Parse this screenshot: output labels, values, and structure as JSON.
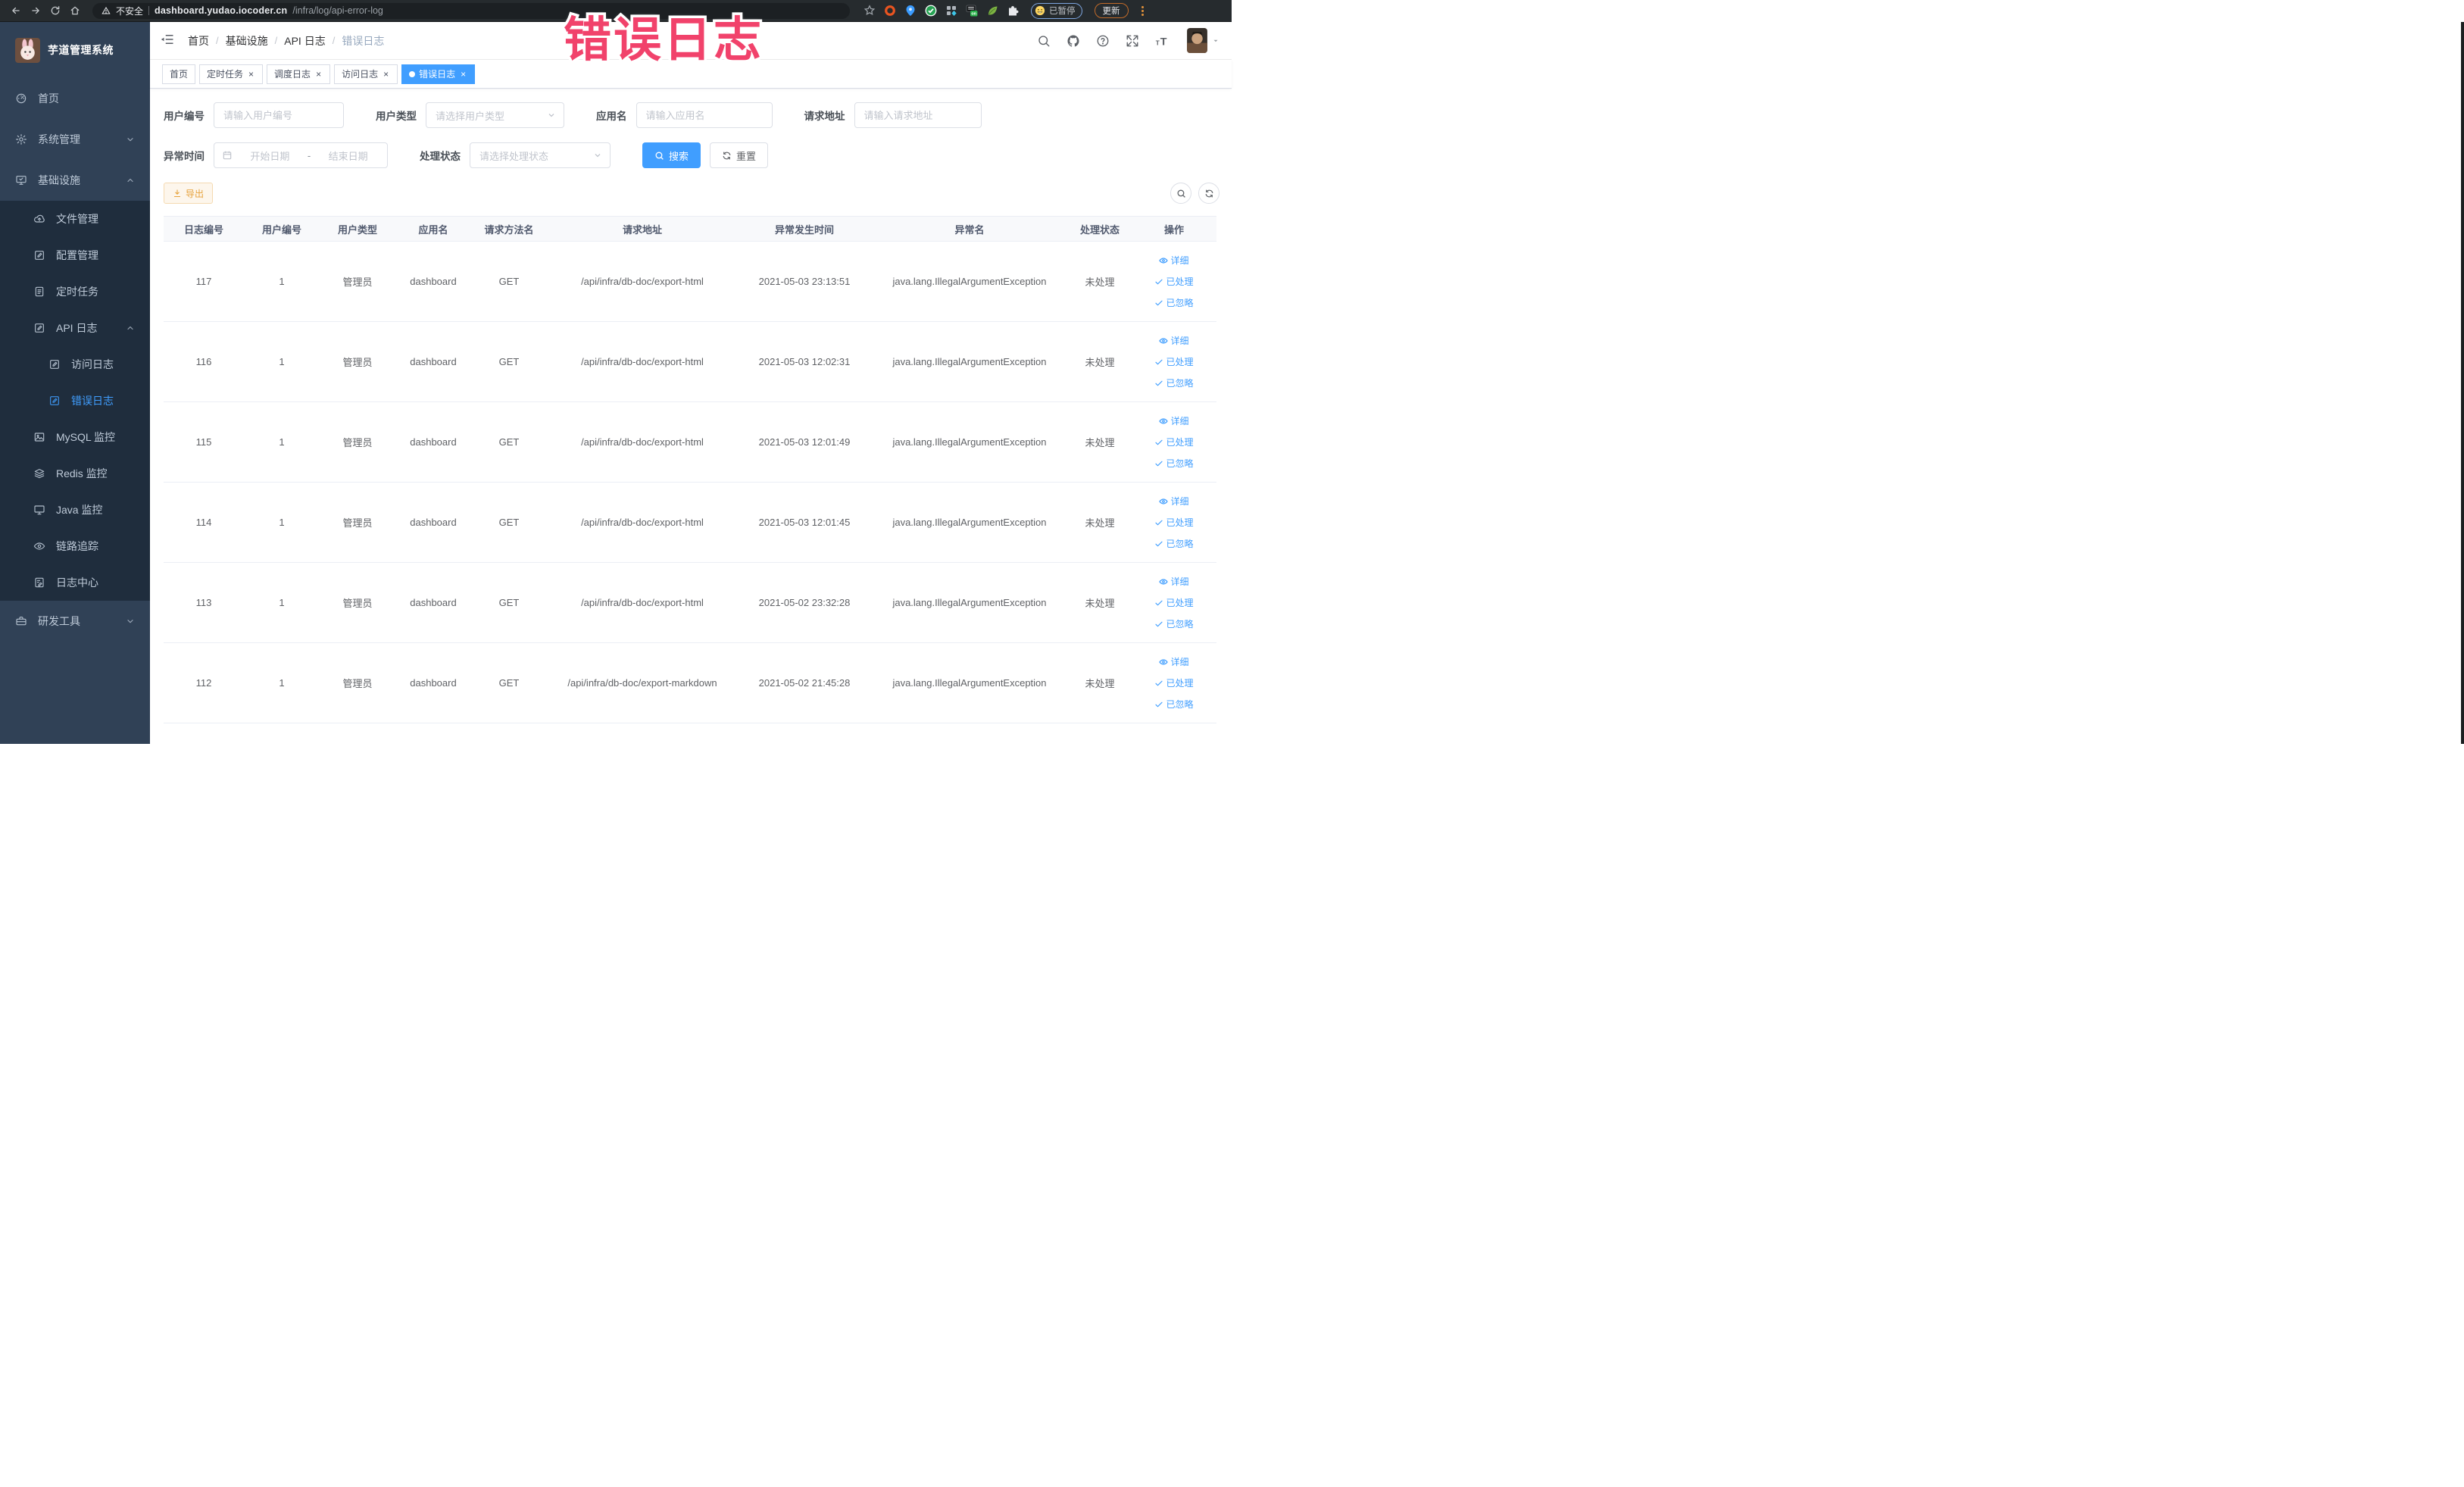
{
  "watermark": {
    "text": "错误日志",
    "color": "#f1426b"
  },
  "browser": {
    "security_label": "不安全",
    "url_host": "dashboard.yudao.iocoder.cn",
    "url_path": "/infra/log/api-error-log",
    "paused_label": "已暂停",
    "update_label": "更新",
    "nav_icons": [
      "arrow-left",
      "arrow-right",
      "reload",
      "home"
    ],
    "extension_icons": [
      "star",
      "orange-ring",
      "blue-pin",
      "green-check",
      "grid",
      "on-switch",
      "leaf",
      "puzzle"
    ]
  },
  "sidebar": {
    "logo_title": "芋道管理系统",
    "items": [
      {
        "label": "首页",
        "icon": "gauge",
        "level": 1
      },
      {
        "label": "系统管理",
        "icon": "gear",
        "level": 1,
        "chevron": "down"
      },
      {
        "label": "基础设施",
        "icon": "monitor-check",
        "level": 1,
        "chevron": "up"
      },
      {
        "label": "文件管理",
        "icon": "cloud-upload",
        "level": 2
      },
      {
        "label": "配置管理",
        "icon": "edit-square",
        "level": 2
      },
      {
        "label": "定时任务",
        "icon": "doc-lines",
        "level": 2
      },
      {
        "label": "API 日志",
        "icon": "edit-square",
        "level": 2,
        "chevron": "up"
      },
      {
        "label": "访问日志",
        "icon": "edit-square",
        "level": 3
      },
      {
        "label": "错误日志",
        "icon": "edit-square",
        "level": 3,
        "active": true
      },
      {
        "label": "MySQL 监控",
        "icon": "picture",
        "level": 2
      },
      {
        "label": "Redis 监控",
        "icon": "layers",
        "level": 2
      },
      {
        "label": "Java 监控",
        "icon": "monitor",
        "level": 2
      },
      {
        "label": "链路追踪",
        "icon": "eye",
        "level": 2
      },
      {
        "label": "日志中心",
        "icon": "edit-doc",
        "level": 2
      },
      {
        "label": "研发工具",
        "icon": "briefcase",
        "level": 1,
        "chevron": "down"
      }
    ]
  },
  "header": {
    "breadcrumb": [
      "首页",
      "基础设施",
      "API 日志",
      "错误日志"
    ],
    "icons": [
      "search",
      "github",
      "help",
      "fullscreen",
      "font-size"
    ]
  },
  "tabs": [
    {
      "label": "首页"
    },
    {
      "label": "定时任务",
      "closable": true
    },
    {
      "label": "调度日志",
      "closable": true
    },
    {
      "label": "访问日志",
      "closable": true
    },
    {
      "label": "错误日志",
      "closable": true,
      "active": true
    }
  ],
  "filters": {
    "user_id": {
      "label": "用户编号",
      "placeholder": "请输入用户编号"
    },
    "user_type": {
      "label": "用户类型",
      "placeholder": "请选择用户类型"
    },
    "app_name": {
      "label": "应用名",
      "placeholder": "请输入应用名"
    },
    "request_url": {
      "label": "请求地址",
      "placeholder": "请输入请求地址"
    },
    "exception_time": {
      "label": "异常时间",
      "start_placeholder": "开始日期",
      "separator": "-",
      "end_placeholder": "结束日期"
    },
    "process_status": {
      "label": "处理状态",
      "placeholder": "请选择处理状态"
    },
    "search_label": "搜索",
    "reset_label": "重置"
  },
  "toolbar": {
    "export_label": "导出"
  },
  "table": {
    "columns": [
      "日志编号",
      "用户编号",
      "用户类型",
      "应用名",
      "请求方法名",
      "请求地址",
      "异常发生时间",
      "异常名",
      "处理状态",
      "操作"
    ],
    "actions": [
      {
        "label": "详细",
        "icon": "eye"
      },
      {
        "label": "已处理",
        "icon": "check"
      },
      {
        "label": "已忽略",
        "icon": "check"
      }
    ],
    "rows": [
      {
        "id": "117",
        "user_id": "1",
        "user_type": "管理员",
        "app": "dashboard",
        "method": "GET",
        "url": "/api/infra/db-doc/export-html",
        "time": "2021-05-03 23:13:51",
        "exception": "java.lang.IllegalArgumentException",
        "status": "未处理"
      },
      {
        "id": "116",
        "user_id": "1",
        "user_type": "管理员",
        "app": "dashboard",
        "method": "GET",
        "url": "/api/infra/db-doc/export-html",
        "time": "2021-05-03 12:02:31",
        "exception": "java.lang.IllegalArgumentException",
        "status": "未处理"
      },
      {
        "id": "115",
        "user_id": "1",
        "user_type": "管理员",
        "app": "dashboard",
        "method": "GET",
        "url": "/api/infra/db-doc/export-html",
        "time": "2021-05-03 12:01:49",
        "exception": "java.lang.IllegalArgumentException",
        "status": "未处理"
      },
      {
        "id": "114",
        "user_id": "1",
        "user_type": "管理员",
        "app": "dashboard",
        "method": "GET",
        "url": "/api/infra/db-doc/export-html",
        "time": "2021-05-03 12:01:45",
        "exception": "java.lang.IllegalArgumentException",
        "status": "未处理"
      },
      {
        "id": "113",
        "user_id": "1",
        "user_type": "管理员",
        "app": "dashboard",
        "method": "GET",
        "url": "/api/infra/db-doc/export-html",
        "time": "2021-05-02 23:32:28",
        "exception": "java.lang.IllegalArgumentException",
        "status": "未处理"
      },
      {
        "id": "112",
        "user_id": "1",
        "user_type": "管理员",
        "app": "dashboard",
        "method": "GET",
        "url": "/api/infra/db-doc/export-markdown",
        "time": "2021-05-02 21:45:28",
        "exception": "java.lang.IllegalArgumentException",
        "status": "未处理"
      }
    ]
  },
  "colors": {
    "accent": "#409eff",
    "sidebar_bg": "#304156",
    "submenu_bg": "#1f2d3d",
    "warning": "#e6a23c"
  }
}
